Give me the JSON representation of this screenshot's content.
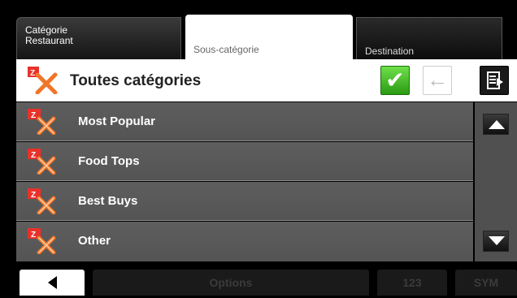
{
  "tabs": {
    "category_line1": "Catégorie",
    "category_line2": "Restaurant",
    "subcategory": "Sous-catégorie",
    "destination": "Destination"
  },
  "header": {
    "title": "Toutes catégories",
    "icon": "category-icon",
    "ok_icon": "checkmark-icon",
    "back_icon": "arrow-left-icon",
    "doc_icon": "document-icon"
  },
  "list": {
    "items": [
      {
        "label": "Most Popular",
        "icon": "category-icon"
      },
      {
        "label": "Food Tops",
        "icon": "category-icon"
      },
      {
        "label": "Best Buys",
        "icon": "category-icon"
      },
      {
        "label": "Other",
        "icon": "category-icon"
      }
    ]
  },
  "footer": {
    "back_icon": "triangle-left-icon",
    "options": "Options",
    "numeric": "123",
    "symbols": "SYM"
  },
  "colors": {
    "accent_green": "#3cbf22",
    "icon_orange": "#f0752a",
    "row_gray": "#585858"
  }
}
